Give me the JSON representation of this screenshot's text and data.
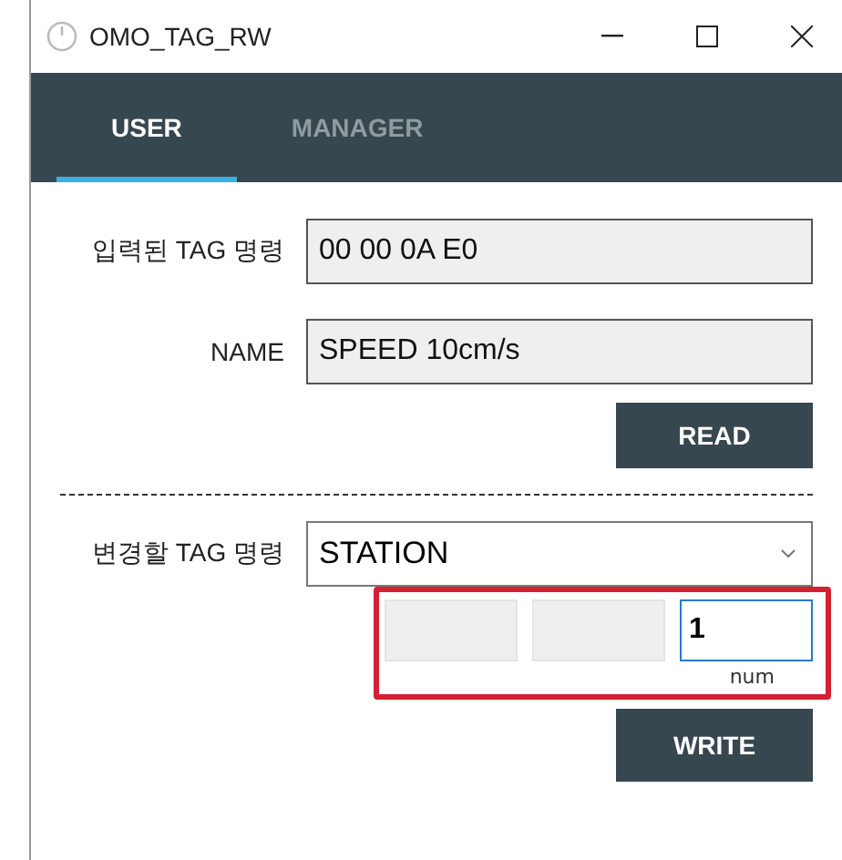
{
  "window": {
    "title": "OMO_TAG_RW"
  },
  "tabs": [
    {
      "label": "USER",
      "selected": true
    },
    {
      "label": "MANAGER",
      "selected": false
    }
  ],
  "read_section": {
    "fields": [
      {
        "label": "입력된 TAG 명령",
        "value": "00 00 0A E0"
      },
      {
        "label": "NAME",
        "value": "SPEED 10cm/s"
      }
    ],
    "button": "READ"
  },
  "write_section": {
    "label": "변경할 TAG 명령",
    "dropdown": {
      "value": "STATION"
    },
    "params": {
      "highlighted": true,
      "inputs": [
        {
          "focused": false
        },
        {
          "focused": false
        },
        {
          "value": "1",
          "focused": true
        }
      ],
      "caption": "num"
    },
    "button": "WRITE"
  }
}
